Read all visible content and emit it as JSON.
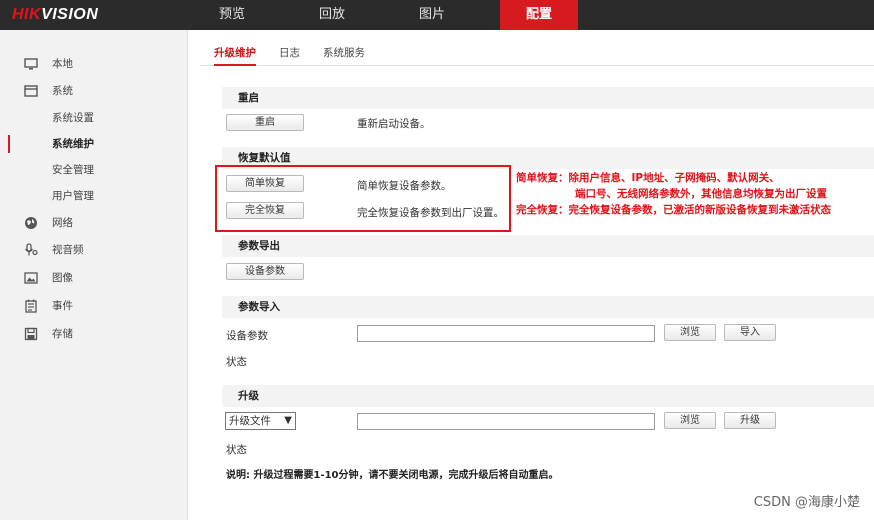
{
  "app": {
    "logo_left": "HIK",
    "logo_right": "VISION"
  },
  "topnav": [
    {
      "label": "预览"
    },
    {
      "label": "回放"
    },
    {
      "label": "图片"
    },
    {
      "label": "配置"
    }
  ],
  "sidebar": {
    "items": [
      {
        "label": "本地",
        "icon": "monitor-icon"
      },
      {
        "label": "系统",
        "icon": "system-icon"
      },
      {
        "label": "系统设置"
      },
      {
        "label": "系统维护"
      },
      {
        "label": "安全管理"
      },
      {
        "label": "用户管理"
      },
      {
        "label": "网络",
        "icon": "globe-icon"
      },
      {
        "label": "视音频",
        "icon": "audio-video-icon"
      },
      {
        "label": "图像",
        "icon": "image-icon"
      },
      {
        "label": "事件",
        "icon": "event-icon"
      },
      {
        "label": "存储",
        "icon": "storage-icon"
      }
    ]
  },
  "tabs": [
    {
      "label": "升级维护"
    },
    {
      "label": "日志"
    },
    {
      "label": "系统服务"
    }
  ],
  "restart": {
    "title": "重启",
    "button": "重启",
    "desc": "重新启动设备。"
  },
  "restore": {
    "title": "恢复默认值",
    "simple_button": "简单恢复",
    "simple_desc": "简单恢复设备参数。",
    "full_button": "完全恢复",
    "full_desc": "完全恢复设备参数到出厂设置。"
  },
  "annotation": {
    "line1": "简单恢复：除用户信息、IP地址、子网掩码、默认网关、",
    "line2": "端口号、无线网络参数外，其他信息均恢复为出厂设置",
    "line3": "完全恢复：完全恢复设备参数，已激活的新版设备恢复到未激活状态",
    "color": "#e3131b"
  },
  "export": {
    "title": "参数导出",
    "button": "设备参数"
  },
  "import": {
    "title": "参数导入",
    "label": "设备参数",
    "browse": "浏览",
    "action": "导入",
    "status": "状态"
  },
  "upgrade": {
    "title": "升级",
    "select_value": "升级文件",
    "browse": "浏览",
    "action": "升级",
    "status": "状态"
  },
  "note": "说明: 升级过程需要1-10分钟，请不要关闭电源，完成升级后将自动重启。",
  "watermark": "CSDN @海康小楚",
  "colors": {
    "accent": "#d71920",
    "topbar": "#2b2b2b",
    "sidebar": "#f2f2f2"
  }
}
